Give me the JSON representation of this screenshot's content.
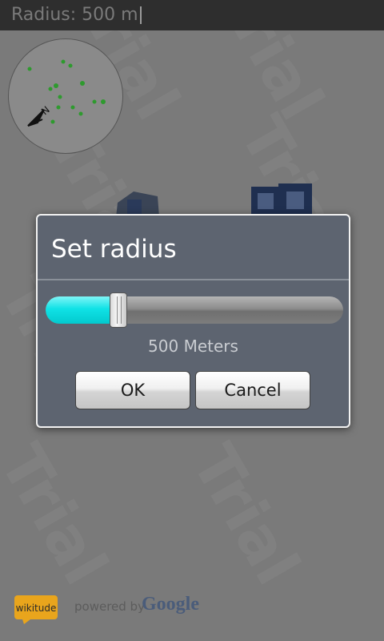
{
  "title_bar": {
    "text": "Radius: 500 m"
  },
  "watermark": {
    "text": "Trial"
  },
  "radar": {
    "icon": "radar-icon",
    "compass": "compass-icon"
  },
  "dialog": {
    "title": "Set radius",
    "slider": {
      "fraction": 0.22,
      "accent": "#1ae3e6"
    },
    "value_label": "500 Meters",
    "ok_label": "OK",
    "cancel_label": "Cancel"
  },
  "footer": {
    "wikitude_logo": "wikitude",
    "powered_by": "powered by",
    "google_logo": "Google"
  }
}
